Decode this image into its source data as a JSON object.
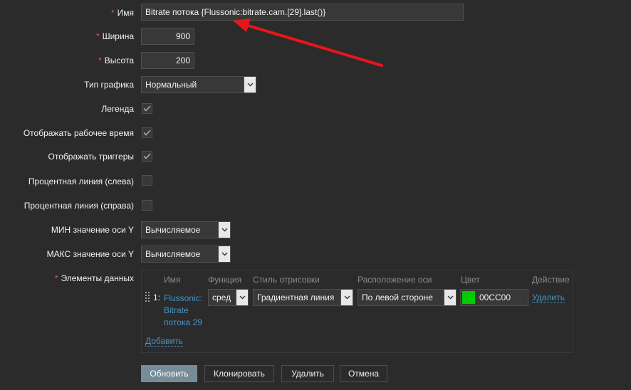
{
  "form": {
    "name": {
      "label": "Имя",
      "value": "Bitrate потока {Flussonic:bitrate.cam.[29].last()}"
    },
    "width": {
      "label": "Ширина",
      "value": "900"
    },
    "height": {
      "label": "Высота",
      "value": "200"
    },
    "graph_type": {
      "label": "Тип графика",
      "value": "Нормальный"
    },
    "legend": {
      "label": "Легенда",
      "checked": true
    },
    "working_time": {
      "label": "Отображать рабочее время",
      "checked": true
    },
    "triggers": {
      "label": "Отображать триггеры",
      "checked": true
    },
    "percent_left": {
      "label": "Процентная линия (слева)",
      "checked": false
    },
    "percent_right": {
      "label": "Процентная линия (справа)",
      "checked": false
    },
    "ymin": {
      "label": "МИН значение оси Y",
      "value": "Вычисляемое"
    },
    "ymax": {
      "label": "МАКС значение оси Y",
      "value": "Вычисляемое"
    },
    "items": {
      "label": "Элементы данных",
      "headers": {
        "name": "Имя",
        "function": "Функция",
        "draw_style": "Стиль отрисовки",
        "axis": "Расположение оси",
        "color": "Цвет",
        "action": "Действие"
      },
      "rows": [
        {
          "index": "1:",
          "name_line1": "Flussonic:",
          "name_line2": "Bitrate",
          "name_line3": "потока 29",
          "function": "сред",
          "draw_style": "Градиентная линия",
          "axis": "По левой стороне",
          "color_hex": "00CC00",
          "color_swatch": "#00cc00",
          "action": "Удалить"
        }
      ],
      "add_link": "Добавить"
    }
  },
  "buttons": {
    "update": "Обновить",
    "clone": "Клонировать",
    "delete": "Удалить",
    "cancel": "Отмена"
  },
  "colors": {
    "accent_link": "#4796c4",
    "required": "#e45959",
    "primary_button": "#768d99",
    "annotation_arrow": "#e8161b"
  }
}
